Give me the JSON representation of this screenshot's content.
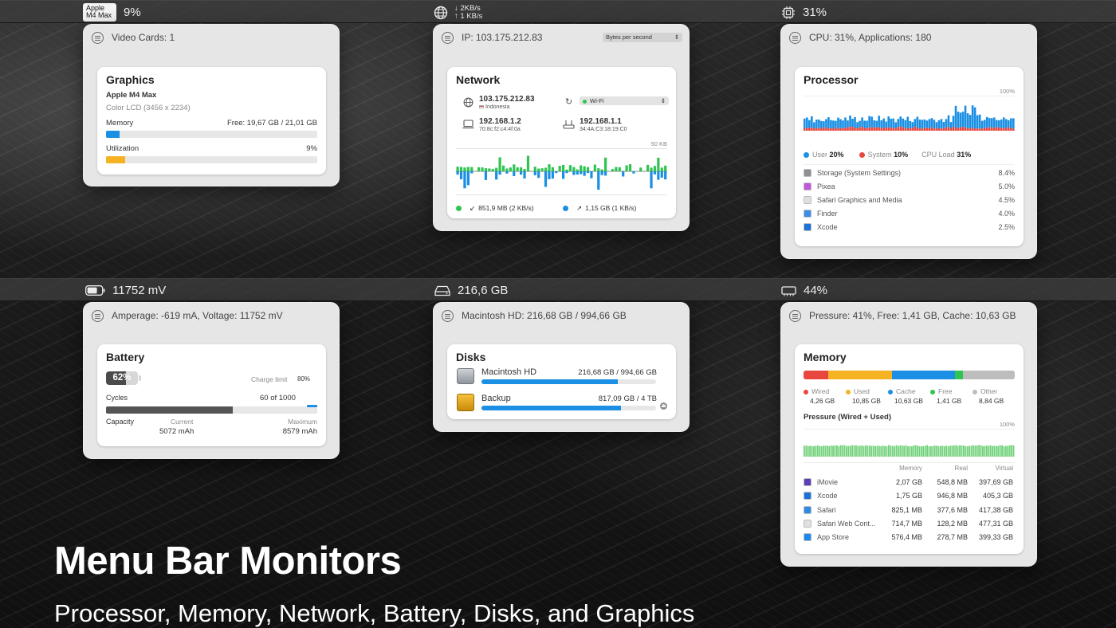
{
  "top_menubar": {
    "gpu_badge": [
      "Apple",
      "M4 Max"
    ],
    "gpu_value": "9%",
    "net_down": "2KB/s",
    "net_up": "1 KB/s",
    "cpu_value": "31%"
  },
  "bottom_menubar": {
    "battery_value": "11752 mV",
    "disk_value": "216,6 GB",
    "memory_value": "44%"
  },
  "graphics_panel": {
    "header": "Video Cards: 1",
    "title": "Graphics",
    "gpu_name": "Apple M4 Max",
    "display": "Color LCD (3456 x 2234)",
    "memory_label": "Memory",
    "memory_value": "Free: 19,67 GB / 21,01 GB",
    "memory_fraction": 0.064,
    "utilization_label": "Utilization",
    "utilization_value": "9%",
    "utilization_fraction": 0.09,
    "colors": {
      "memory": "#1a8fe3",
      "utilization": "#f5b324"
    }
  },
  "network_panel": {
    "header": "IP: 103.175.212.83",
    "unit_select": "Bytes per second",
    "title": "Network",
    "public_ip": "103.175.212.83",
    "country": "Indonesia",
    "interface": "Wi-Fi",
    "local_ip": "192.168.1.2",
    "local_mac": "70:8c:f2:c4:4f:0a",
    "router_ip": "192.168.1.1",
    "router_mac": "34:4A:C3:18:19:C0",
    "chart_max": "50 KB",
    "download_total": "851,9 MB (2 KB/s)",
    "upload_total": "1,15 GB (1 KB/s)",
    "colors": {
      "download": "#30c452",
      "upload": "#1a8fe3"
    }
  },
  "processor_panel": {
    "header": "CPU: 31%, Applications: 180",
    "title": "Processor",
    "chart_max": "100%",
    "user_label": "User",
    "user_value": "20%",
    "system_label": "System",
    "system_value": "10%",
    "load_label": "CPU Load",
    "load_value": "31%",
    "apps": [
      {
        "name": "Storage (System Settings)",
        "value": "8.4%"
      },
      {
        "name": "Pixea",
        "value": "5.0%"
      },
      {
        "name": "Safari Graphics and Media",
        "value": "4.5%"
      },
      {
        "name": "Finder",
        "value": "4.0%"
      },
      {
        "name": "Xcode",
        "value": "2.5%"
      }
    ],
    "colors": {
      "user": "#1a8fe3",
      "system": "#e8473f"
    }
  },
  "battery_panel": {
    "header": "Amperage: -619 mA, Voltage: 11752 mV",
    "title": "Battery",
    "charge": "62%",
    "charge_fraction": 0.62,
    "charge_limit_label": "Charge limit",
    "charge_limit_value": "80%",
    "cycles_label": "Cycles",
    "cycles_value": "60 of 1000",
    "capacity_fraction": 0.6,
    "capacity_label": "Capacity",
    "current_label": "Current",
    "current_value": "5072 mAh",
    "maximum_label": "Maximum",
    "maximum_value": "8579 mAh"
  },
  "disks_panel": {
    "header": "Macintosh HD: 216,68 GB / 994,66 GB",
    "title": "Disks",
    "disks": [
      {
        "name": "Macintosh HD",
        "usage": "216,68 GB / 994,66 GB",
        "fraction": 0.78
      },
      {
        "name": "Backup",
        "usage": "817,09 GB / 4 TB",
        "fraction": 0.8
      }
    ]
  },
  "memory_panel": {
    "header": "Pressure: 41%, Free: 1,41 GB, Cache: 10,63 GB",
    "title": "Memory",
    "segments": [
      {
        "label": "Wired",
        "value": "4,26 GB",
        "color": "#e8473f",
        "gb": 4.26
      },
      {
        "label": "Used",
        "value": "10,85 GB",
        "color": "#f5b324",
        "gb": 10.85
      },
      {
        "label": "Cache",
        "value": "10,63 GB",
        "color": "#1a8fe3",
        "gb": 10.63
      },
      {
        "label": "Free",
        "value": "1,41 GB",
        "color": "#30c452",
        "gb": 1.41
      },
      {
        "label": "Other",
        "value": "8,84 GB",
        "color": "#bdbdbd",
        "gb": 8.84
      }
    ],
    "pressure_label": "Pressure (Wired + Used)",
    "pressure_max": "100%",
    "columns": [
      "Memory",
      "Real",
      "Virtual"
    ],
    "apps": [
      {
        "name": "iMovie",
        "memory": "2,07 GB",
        "real": "548,8 MB",
        "virtual": "397,69 GB"
      },
      {
        "name": "Xcode",
        "memory": "1,75 GB",
        "real": "946,8 MB",
        "virtual": "405,3 GB"
      },
      {
        "name": "Safari",
        "memory": "825,1 MB",
        "real": "377,6 MB",
        "virtual": "417,38 GB"
      },
      {
        "name": "Safari Web Cont...",
        "memory": "714,7 MB",
        "real": "128,2 MB",
        "virtual": "477,31 GB"
      },
      {
        "name": "App Store",
        "memory": "576,4 MB",
        "real": "278,7 MB",
        "virtual": "399,33 GB"
      }
    ]
  },
  "hero": {
    "title": "Menu Bar Monitors",
    "subtitle": "Processor, Memory, Network, Battery, Disks, and Graphics"
  }
}
